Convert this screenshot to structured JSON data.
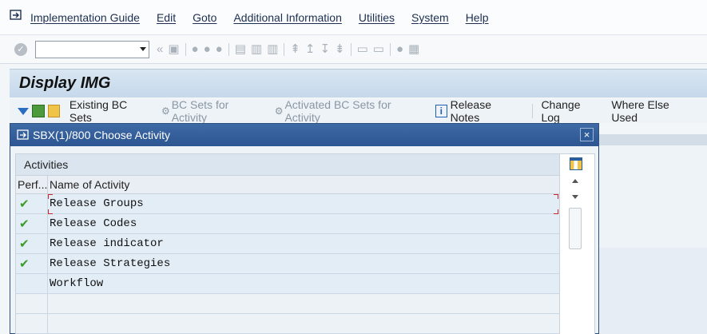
{
  "menubar": {
    "items": [
      "Implementation Guide",
      "Edit",
      "Goto",
      "Additional Information",
      "Utilities",
      "System",
      "Help"
    ]
  },
  "toolbar": {
    "command_field_value": ""
  },
  "title": "Display IMG",
  "app_toolbar": {
    "existing_bc_sets": "Existing BC Sets",
    "bc_sets_for_activity": "BC Sets for Activity",
    "activated_bc_sets": "Activated BC Sets for Activity",
    "release_notes": "Release Notes",
    "change_log": "Change Log",
    "where_else_used": "Where Else Used"
  },
  "dialog": {
    "title": "SBX(1)/800 Choose Activity",
    "close_glyph": "×",
    "caption": "Activities",
    "columns": [
      "Perf...",
      "Name of Activity"
    ],
    "rows": [
      {
        "performed": true,
        "name": "Release Groups"
      },
      {
        "performed": true,
        "name": "Release Codes"
      },
      {
        "performed": true,
        "name": "Release indicator"
      },
      {
        "performed": true,
        "name": "Release Strategies"
      },
      {
        "performed": false,
        "name": "Workflow"
      },
      {
        "performed": false,
        "name": ""
      },
      {
        "performed": false,
        "name": ""
      }
    ]
  },
  "colors": {
    "dialog_header": "#2c5591",
    "check": "#3e9b2a",
    "row_bg": "#e3edf6"
  }
}
